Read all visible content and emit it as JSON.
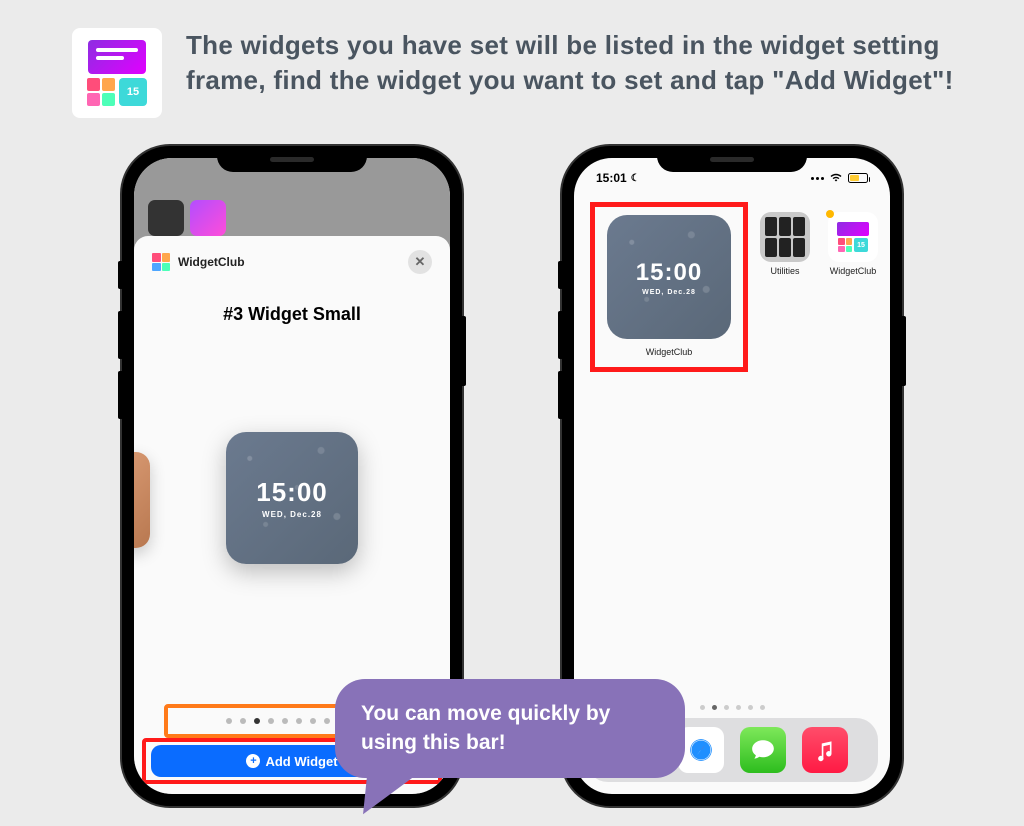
{
  "header": {
    "text": "The widgets you have set will be listed in the widget setting frame, find the widget you want to set and tap \"Add Widget\"!"
  },
  "appIcon": {
    "badgeNumber": "15"
  },
  "phone1": {
    "sheet": {
      "title": "WidgetClub",
      "heading": "#3 Widget Small"
    },
    "widget": {
      "time": "15:00",
      "date": "WED, Dec.28"
    },
    "addButton": "Add Widget"
  },
  "phone2": {
    "status": {
      "time": "15:01"
    },
    "widget": {
      "time": "15:00",
      "date": "WED, Dec.28",
      "label": "WidgetClub"
    },
    "apps": {
      "utilities": "Utilities",
      "widgetclub": "WidgetClub"
    }
  },
  "bubble": {
    "text": "You can move quickly by using this bar!"
  }
}
